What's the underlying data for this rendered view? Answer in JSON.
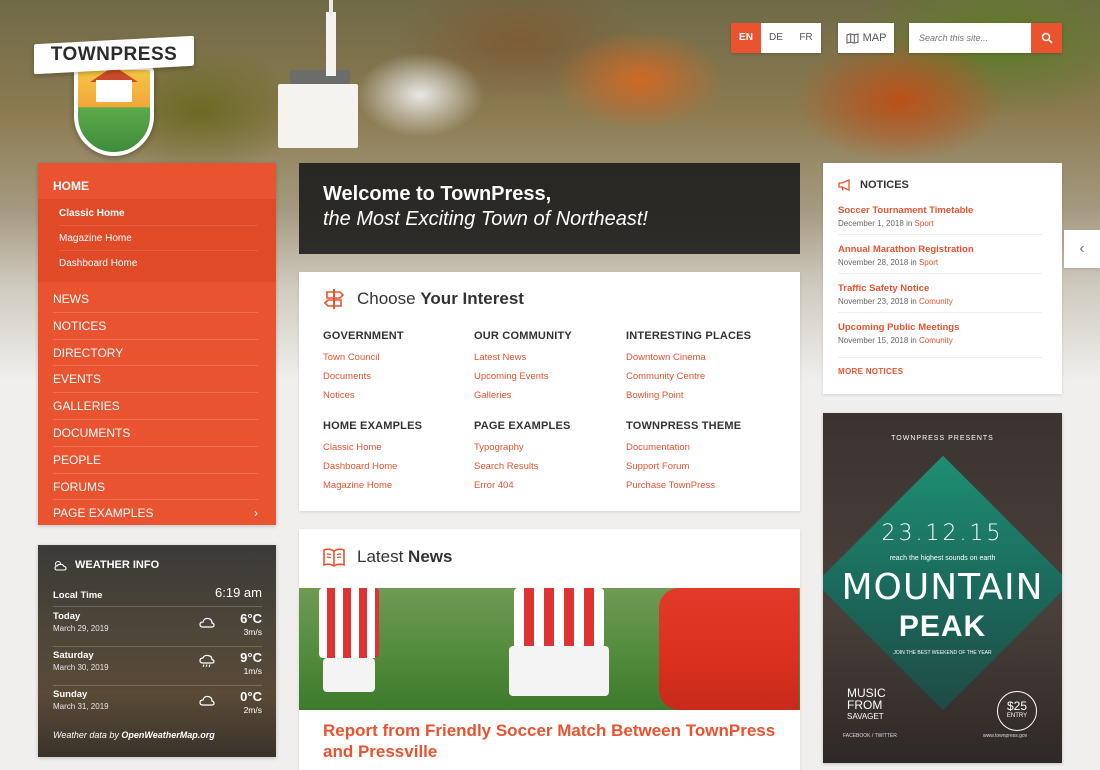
{
  "brand": {
    "name": "TOWNPRESS"
  },
  "languages": [
    {
      "code": "EN",
      "active": true
    },
    {
      "code": "DE",
      "active": false
    },
    {
      "code": "FR",
      "active": false
    }
  ],
  "map_label": "MAP",
  "search": {
    "placeholder": "Search this site..."
  },
  "nav": {
    "home": "HOME",
    "sub": [
      "Classic Home",
      "Magazine Home",
      "Dashboard Home"
    ],
    "items": [
      "NEWS",
      "NOTICES",
      "DIRECTORY",
      "EVENTS",
      "GALLERIES",
      "DOCUMENTS",
      "PEOPLE",
      "FORUMS",
      "PAGE EXAMPLES"
    ]
  },
  "weather": {
    "title": "WEATHER INFO",
    "local_label": "Local Time",
    "local_time": "6:19 am",
    "days": [
      {
        "day": "Today",
        "date": "March 29, 2019",
        "temp": "6°C",
        "wind": "3m/s"
      },
      {
        "day": "Saturday",
        "date": "March 30, 2019",
        "temp": "9°C",
        "wind": "1m/s"
      },
      {
        "day": "Sunday",
        "date": "March 31, 2019",
        "temp": "0°C",
        "wind": "2m/s"
      }
    ],
    "footer_prefix": "Weather data by ",
    "footer_source": "OpenWeatherMap.org"
  },
  "welcome": {
    "line1": "Welcome to TownPress,",
    "line2": "the Most Exciting Town of Northeast!"
  },
  "interest": {
    "heading_light": "Choose",
    "heading_bold": "Your Interest",
    "columns": [
      {
        "title": "GOVERNMENT",
        "links": [
          "Town Council",
          "Documents",
          "Notices"
        ]
      },
      {
        "title": "OUR COMMUNITY",
        "links": [
          "Latest News",
          "Upcoming Events",
          "Galleries"
        ]
      },
      {
        "title": "INTERESTING PLACES",
        "links": [
          "Downtown Cinema",
          "Community Centre",
          "Bowling Point"
        ]
      },
      {
        "title": "HOME EXAMPLES",
        "links": [
          "Classic Home",
          "Dashboard Home",
          "Magazine Home"
        ]
      },
      {
        "title": "PAGE EXAMPLES",
        "links": [
          "Typography",
          "Search Results",
          "Error 404"
        ]
      },
      {
        "title": "TOWNPRESS THEME",
        "links": [
          "Documentation",
          "Support Forum",
          "Purchase TownPress"
        ]
      }
    ]
  },
  "news": {
    "heading_light": "Latest",
    "heading_bold": "News",
    "article_title": "Report from Friendly Soccer Match Between TownPress and Pressville"
  },
  "notices": {
    "title": "NOTICES",
    "items": [
      {
        "title": "Soccer Tournament Timetable",
        "date": "December 1, 2018",
        "category": "Sport"
      },
      {
        "title": "Annual Marathon Registration",
        "date": "November 28, 2018",
        "category": "Sport"
      },
      {
        "title": "Traffic Safety Notice",
        "date": "November 23, 2018",
        "category": "Comunity"
      },
      {
        "title": "Upcoming Public Meetings",
        "date": "November 15, 2018",
        "category": "Comunity"
      }
    ],
    "in_word": "in",
    "more": "MORE NOTICES"
  },
  "poster": {
    "presents": "TOWNPRESS PRESENTS",
    "date": "23.12.15",
    "tagline": "reach the highest sounds on earth",
    "title1": "MOUNTAIN",
    "title2": "PEAK",
    "sub": "JOIN THE BEST WEEKEND OF THE YEAR",
    "music1": "MUSIC",
    "music2": "FROM",
    "music3": "SAVAGET",
    "price": "$25",
    "price_sub": "ENTRY",
    "social": "FACEBOOK  /  TWITTER",
    "site": "www.townpress.gov"
  },
  "colors": {
    "accent": "#e9532f",
    "dark": "#1e1e1e"
  }
}
